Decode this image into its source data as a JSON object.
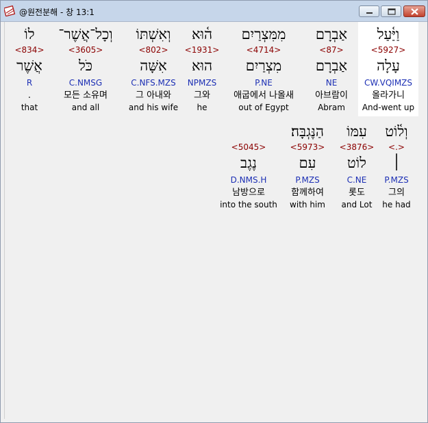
{
  "window": {
    "title": "@원전분해 - 창 13:1",
    "app_icon": "bible-book-icon",
    "controls": {
      "minimize": "minimize-icon",
      "maximize": "maximize-icon",
      "close": "close-icon"
    }
  },
  "colors": {
    "strong_number": "#8b0000",
    "parsing": "#1c2fb4",
    "highlight": "#ffffff"
  },
  "lines": [
    [
      {
        "hebrew": "וַיַּ֫עַל",
        "strong": "<5927>",
        "lemma": "עָלָה",
        "parsing": "CW.VQIMZS",
        "korean": "올라가니",
        "english": "And-went up",
        "highlight": true
      },
      {
        "hebrew": "אַבְרָם",
        "strong": "<87>",
        "lemma": "אַבְרָם",
        "parsing": "NE",
        "korean": "아브람이",
        "english": "Abram",
        "highlight": false
      },
      {
        "hebrew": "מִמִּצְרַיִם",
        "strong": "<4714>",
        "lemma": "מִצְרַיִם",
        "parsing": "P.NE",
        "korean": "애굽에서 나올새",
        "english": "out of Egypt",
        "highlight": false
      },
      {
        "hebrew": "ה֫וּא",
        "strong": "<1931>",
        "lemma": "הוּא",
        "parsing": "NPMZS",
        "korean": "그와",
        "english": "he",
        "highlight": false
      },
      {
        "hebrew": "וְאִשְׁתּוֹ",
        "strong": "<802>",
        "lemma": "אִשָּׁה",
        "parsing": "C.NFS.MZS",
        "korean": "그 아내와",
        "english": "and his wife",
        "highlight": false
      },
      {
        "hebrew": "וְכָל־אֲשֶׁר־",
        "strong": "<3605>",
        "lemma": "כֹּל",
        "parsing": "C.NMSG",
        "korean": "모든 소유며",
        "english": "and all",
        "highlight": false
      },
      {
        "hebrew": "לוֹ",
        "strong": "<834>",
        "lemma": "אֲשֶׁר",
        "parsing": "R",
        "korean": ".",
        "english": "that",
        "highlight": false
      }
    ],
    [
      {
        "hebrew": "וְל֫וֹט",
        "strong": "<.>",
        "lemma": "׀",
        "parsing": "P.MZS",
        "korean": "그의",
        "english": "he had",
        "highlight": false
      },
      {
        "hebrew": "עִמּוֹ",
        "strong": "<3876>",
        "lemma": "לוֹט",
        "parsing": "C.NE",
        "korean": "롯도",
        "english": "and Lot",
        "highlight": false
      },
      {
        "hebrew": "הַנֶּגְבָּה׃",
        "strong": "<5973>",
        "lemma": "עִם",
        "parsing": "P.MZS",
        "korean": "함께하여",
        "english": "with him",
        "highlight": false
      },
      {
        "hebrew": "",
        "strong": "<5045>",
        "lemma": "נֶגֶב",
        "parsing": "D.NMS.H",
        "korean": "남방으로",
        "english": "into the south",
        "highlight": false
      }
    ]
  ]
}
